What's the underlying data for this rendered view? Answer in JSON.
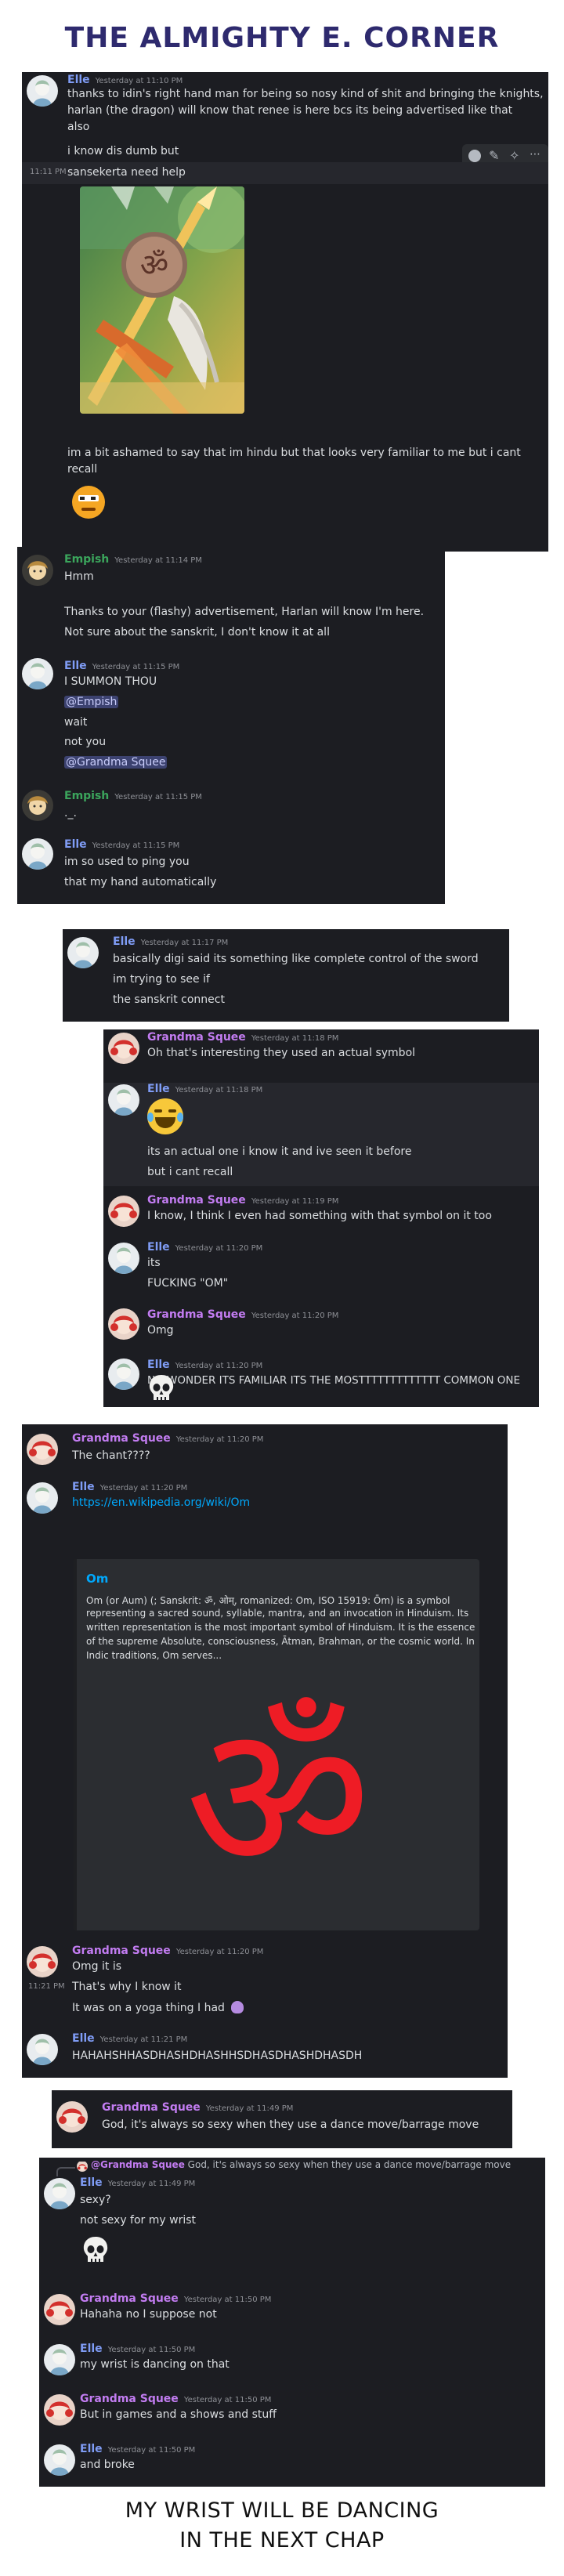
{
  "header": {
    "title": "THE ALMIGHTY E. CORNER"
  },
  "footer": {
    "line1": "MY WRIST WILL BE DANCING",
    "line2": "IN THE NEXT CHAP"
  },
  "users": {
    "elle": {
      "name": "Elle",
      "color": "#7f9cf5"
    },
    "empish": {
      "name": "Empish",
      "color": "#3ba55c"
    },
    "gs": {
      "name": "Grandma Squee",
      "color": "#c27cf1"
    }
  },
  "p1": {
    "m1": {
      "name": "Elle",
      "time": "Yesterday at 11:10 PM",
      "l1": "thanks to idin's right hand man for being so nosy kind of shit and bringing the knights,",
      "l2": "harlan (the dragon) will know that renee is here bcs its being advertised like that",
      "l3": "also",
      "l4": "i know dis dumb but"
    },
    "side_time": "11:11 PM",
    "l5": "sansekerta need help",
    "l6": "im a bit ashamed to say that im hindu but that looks very familiar to me but i cant",
    "l7": "recall"
  },
  "p2": {
    "m1": {
      "name": "Empish",
      "time": "Yesterday at 11:14 PM",
      "l1": "Hmm",
      "l2": "Thanks to your (flashy) advertisement, Harlan will know I'm here.",
      "l3": "Not sure about the sanskrit, I don't know it at all"
    },
    "m2": {
      "name": "Elle",
      "time": "Yesterday at 11:15 PM",
      "l1": "I SUMMON THOU",
      "l2": "@Empish",
      "l3": "wait",
      "l4": "not you",
      "l5": "@Grandma Squee"
    },
    "m3": {
      "name": "Empish",
      "time": "Yesterday at 11:15 PM",
      "l1": "._."
    },
    "m4": {
      "name": "Elle",
      "time": "Yesterday at 11:15 PM",
      "l1": "im so used to ping you",
      "l2": "that my hand automatically"
    }
  },
  "p3": {
    "m1": {
      "name": "Elle",
      "time": "Yesterday at 11:17 PM",
      "l1": "basically digi said its something like complete control of the sword",
      "l2": "im trying to see if",
      "l3": "the sanskrit connect"
    }
  },
  "p4": {
    "m1": {
      "name": "Grandma Squee",
      "time": "Yesterday at 11:18 PM",
      "l1": "Oh that's interesting they used an actual symbol"
    },
    "m2": {
      "name": "Elle",
      "time": "Yesterday at 11:18 PM",
      "l1": "its an actual one i know it and ive seen it before",
      "l2": "but i cant recall"
    },
    "m3": {
      "name": "Grandma Squee",
      "time": "Yesterday at 11:19 PM",
      "l1": "I know, I think I even had something with that symbol on it too"
    },
    "m4": {
      "name": "Elle",
      "time": "Yesterday at 11:20 PM",
      "l1": "its",
      "l2": "FUCKING \"OM\""
    },
    "m5": {
      "name": "Grandma Squee",
      "time": "Yesterday at 11:20 PM",
      "l1": "Omg"
    },
    "m6": {
      "name": "Elle",
      "time": "Yesterday at 11:20 PM",
      "l1": "NO WONDER ITS FAMILIAR ITS THE MOSTTTTTTTTTTTTT COMMON ONE"
    }
  },
  "p5": {
    "m1": {
      "name": "Grandma Squee",
      "time": "Yesterday at 11:20 PM",
      "l1": "The chant????"
    },
    "m2": {
      "name": "Elle",
      "time": "Yesterday at 11:20 PM",
      "link": "https://en.wikipedia.org/wiki/Om"
    },
    "embed": {
      "title": "Om",
      "l1": "Om (or Aum) (; Sanskrit: ॐ, ओम्, romanized: Om, ISO 15919: Ōm) is a symbol",
      "l2": "representing a sacred sound, syllable, mantra, and an invocation in Hinduism. Its",
      "l3": "written representation is the most important symbol of Hinduism. It is the essence",
      "l4": "of the supreme Absolute, consciousness, Ātman, Brahman, or the cosmic world. In",
      "l5": "Indic traditions, Om serves...",
      "symbol": "ॐ"
    },
    "m3": {
      "name": "Grandma Squee",
      "time": "Yesterday at 11:20 PM",
      "l1": "Omg it is"
    },
    "side_time": "11:21 PM",
    "l2": "That's why I know it",
    "l3": "It was on a yoga thing I had",
    "m4": {
      "name": "Elle",
      "time": "Yesterday at 11:21 PM",
      "l1": "HAHAHSHHASDHASHDHASHHSDHASDHASHDHASDH"
    }
  },
  "p6": {
    "m1": {
      "name": "Grandma Squee",
      "time": "Yesterday at 11:49 PM",
      "l1": "God, it's always so sexy when they use a dance move/barrage move"
    }
  },
  "p7": {
    "reply": {
      "name": "@Grandma Squee",
      "text": "God, it's always so sexy when they use a dance move/barrage move"
    },
    "m1": {
      "name": "Elle",
      "time": "Yesterday at 11:49 PM",
      "l1": "sexy?",
      "l2": "not sexy for my wrist"
    },
    "m2": {
      "name": "Grandma Squee",
      "time": "Yesterday at 11:50 PM",
      "l1": "Hahaha no I suppose not"
    },
    "m3": {
      "name": "Elle",
      "time": "Yesterday at 11:50 PM",
      "l1": "my wrist is dancing on that"
    },
    "m4": {
      "name": "Grandma Squee",
      "time": "Yesterday at 11:50 PM",
      "l1": "But in games and a shows and stuff"
    },
    "m5": {
      "name": "Elle",
      "time": "Yesterday at 11:50 PM",
      "l1": "and broke"
    }
  }
}
